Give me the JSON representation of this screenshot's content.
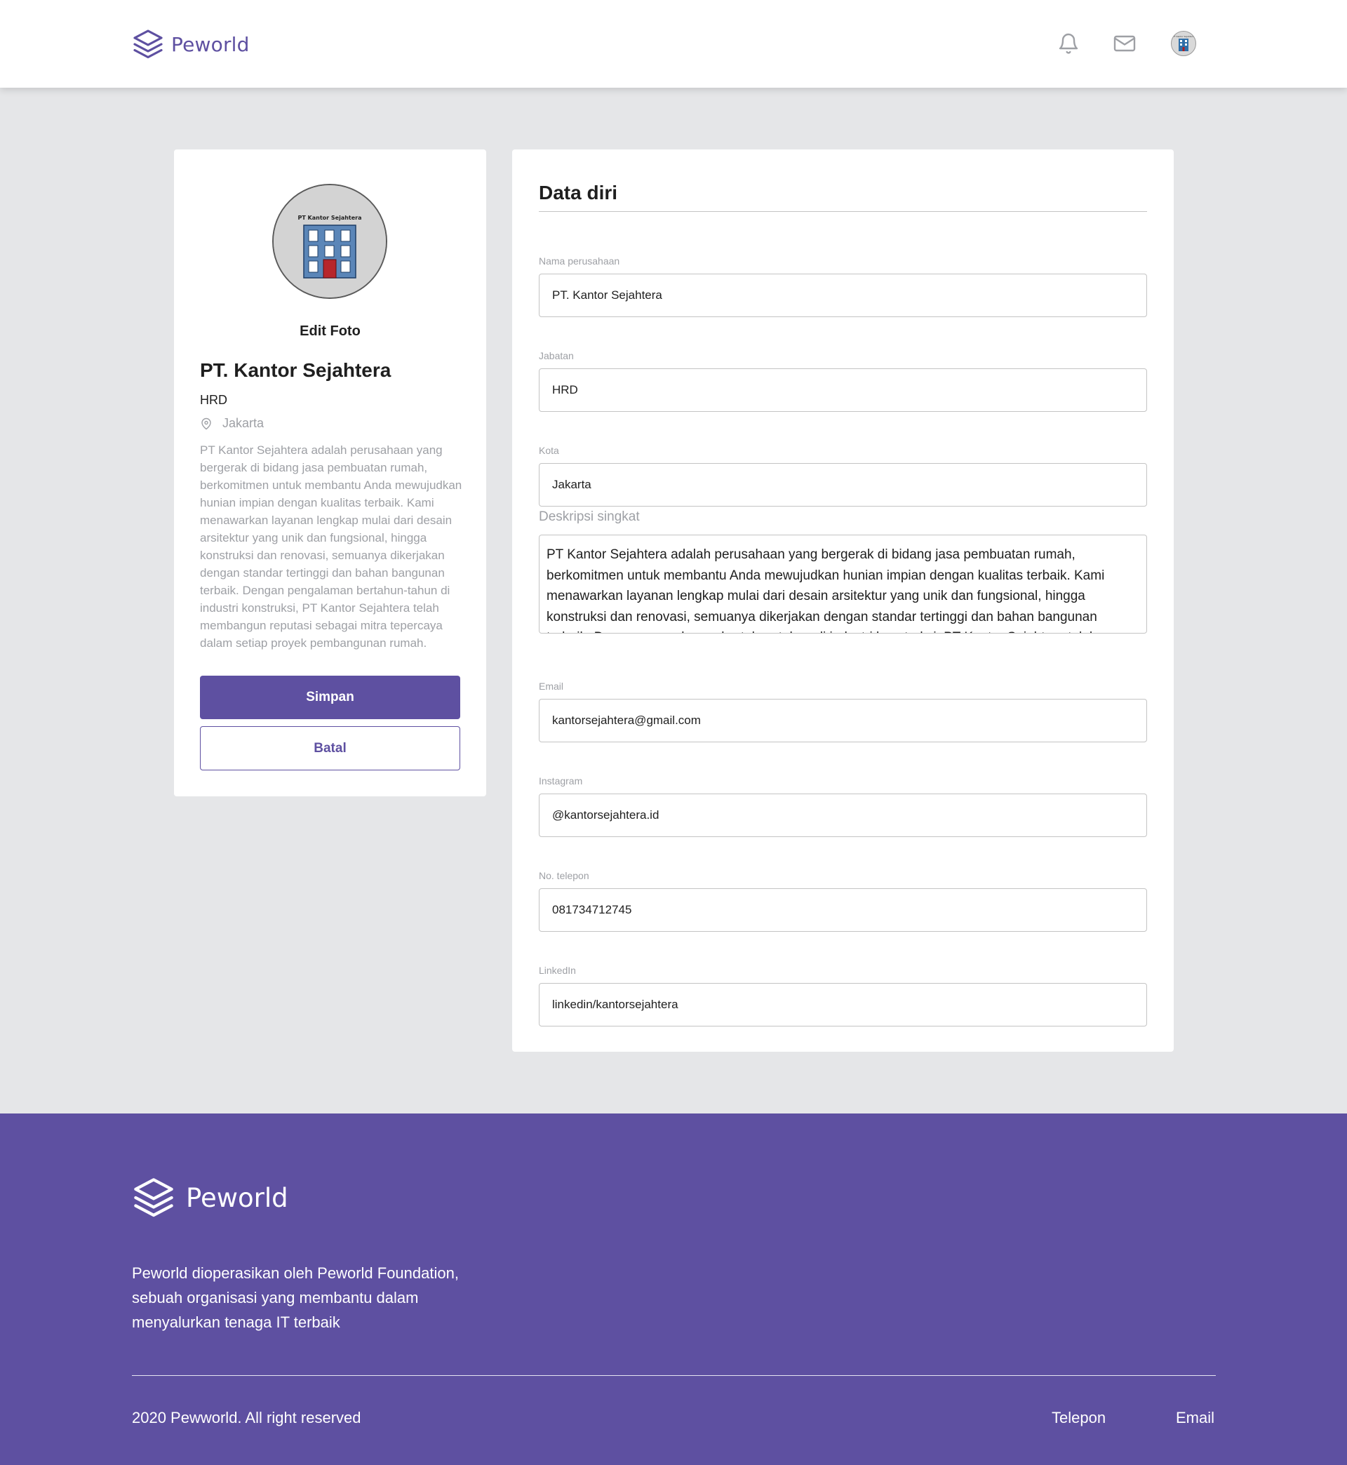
{
  "brand": {
    "name": "Peworld",
    "color": "#5e50a1"
  },
  "navbar": {
    "icons": [
      "bell-icon",
      "mail-icon"
    ],
    "avatar": "company-avatar",
    "avatar_text": "PT Kantor Sejahtera"
  },
  "profile": {
    "photo_caption": "PT Kantor Sejahtera",
    "edit_photo_label": "Edit Foto",
    "company_name": "PT. Kantor Sejahtera",
    "position": "HRD",
    "location": "Jakarta",
    "description": "PT Kantor Sejahtera adalah perusahaan yang bergerak di bidang jasa pembuatan rumah, berkomitmen untuk membantu Anda mewujudkan hunian impian dengan kualitas terbaik. Kami menawarkan layanan lengkap mulai dari desain arsitektur yang unik dan fungsional, hingga konstruksi dan renovasi, semuanya dikerjakan dengan standar tertinggi dan bahan bangunan terbaik. Dengan pengalaman bertahun-tahun di industri konstruksi, PT Kantor Sejahtera telah membangun reputasi sebagai mitra tepercaya dalam setiap proyek pembangunan rumah.",
    "save_label": "Simpan",
    "cancel_label": "Batal"
  },
  "form": {
    "title": "Data diri",
    "fields": {
      "company_name": {
        "label": "Nama perusahaan",
        "value": "PT. Kantor Sejahtera"
      },
      "position": {
        "label": "Jabatan",
        "value": "HRD"
      },
      "city": {
        "label": "Kota",
        "value": "Jakarta"
      },
      "description": {
        "label": "Deskripsi singkat",
        "value": "PT Kantor Sejahtera adalah perusahaan yang bergerak di bidang jasa pembuatan rumah, berkomitmen untuk membantu Anda mewujudkan hunian impian dengan kualitas terbaik. Kami menawarkan layanan lengkap mulai dari desain arsitektur yang unik dan fungsional, hingga konstruksi dan renovasi, semuanya dikerjakan dengan standar tertinggi dan bahan bangunan terbaik. Dengan pengalaman bertahun-tahun di industri konstruksi, PT Kantor Sejahtera telah membangun reputasi sebagai mitra tepercaya dalam setiap proyek pembangunan rumah."
      },
      "email": {
        "label": "Email",
        "value": "kantorsejahtera@gmail.com"
      },
      "instagram": {
        "label": "Instagram",
        "value": "@kantorsejahtera.id"
      },
      "phone": {
        "label": "No. telepon",
        "value": "081734712745"
      },
      "linkedin": {
        "label": "LinkedIn",
        "value": "linkedin/kantorsejahtera"
      }
    }
  },
  "footer": {
    "brand": "Peworld",
    "description": "Peworld dioperasikan oleh Peworld Foundation, sebuah organisasi yang membantu dalam menyalurkan tenaga IT terbaik",
    "copyright": "2020 Pewworld. All right reserved",
    "links": [
      "Telepon",
      "Email"
    ]
  }
}
